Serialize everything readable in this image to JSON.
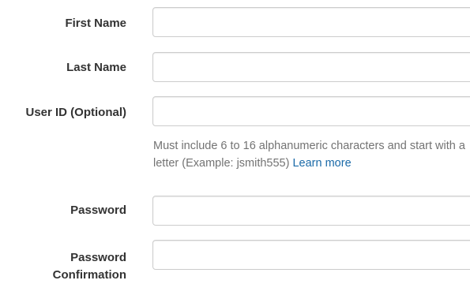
{
  "form": {
    "first_name": {
      "label": "First Name",
      "value": "",
      "placeholder": ""
    },
    "last_name": {
      "label": "Last Name",
      "value": "",
      "placeholder": ""
    },
    "user_id": {
      "label": "User ID (Optional)",
      "value": "",
      "placeholder": "",
      "help_text": "Must include 6 to 16 alphanumeric characters and start with a letter (Example: jsmith555)",
      "help_link": "Learn more"
    },
    "password": {
      "label": "Password",
      "value": "",
      "placeholder": ""
    },
    "password_confirmation": {
      "label_line1": "Password",
      "label_line2": "Confirmation",
      "value": "",
      "placeholder": ""
    }
  },
  "colors": {
    "label_text": "#333333",
    "help_text": "#737373",
    "link": "#1a6aa8",
    "input_border": "#cccccc"
  }
}
